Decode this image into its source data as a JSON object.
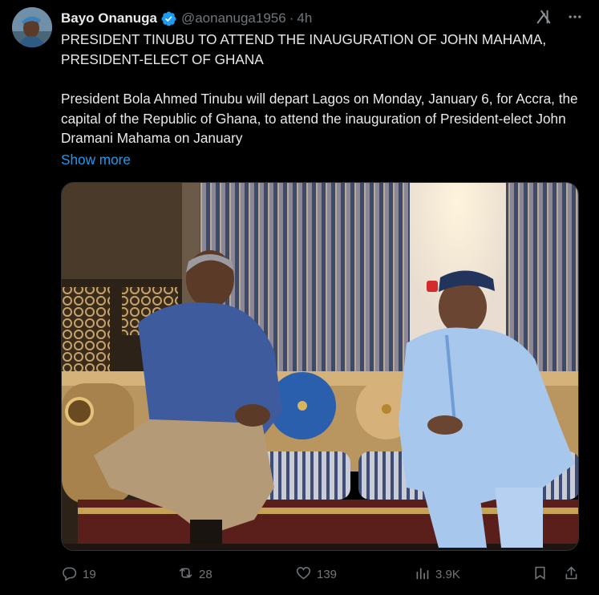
{
  "post": {
    "author_name": "Bayo Onanuga",
    "handle": "@aonanuga1956",
    "separator": "·",
    "time": "4h",
    "verified_color": "#1d9bf0",
    "paragraphs": [
      "PRESIDENT TINUBU TO ATTEND THE INAUGURATION OF JOHN MAHAMA, PRESIDENT-ELECT OF GHANA",
      "President Bola Ahmed Tinubu will depart Lagos on Monday, January 6, for Accra, the capital of the Republic of Ghana, to attend the inauguration of President-elect John Dramani Mahama on January"
    ],
    "show_more": "Show more"
  },
  "header_icons": [
    "grok-icon",
    "more-options-icon"
  ],
  "actions": {
    "replies": "19",
    "reposts": "28",
    "likes": "139",
    "views": "3.9K"
  },
  "colors": {
    "background": "#000000",
    "text": "#e7e9ea",
    "muted": "#71767b",
    "link": "#1d9bf0"
  }
}
